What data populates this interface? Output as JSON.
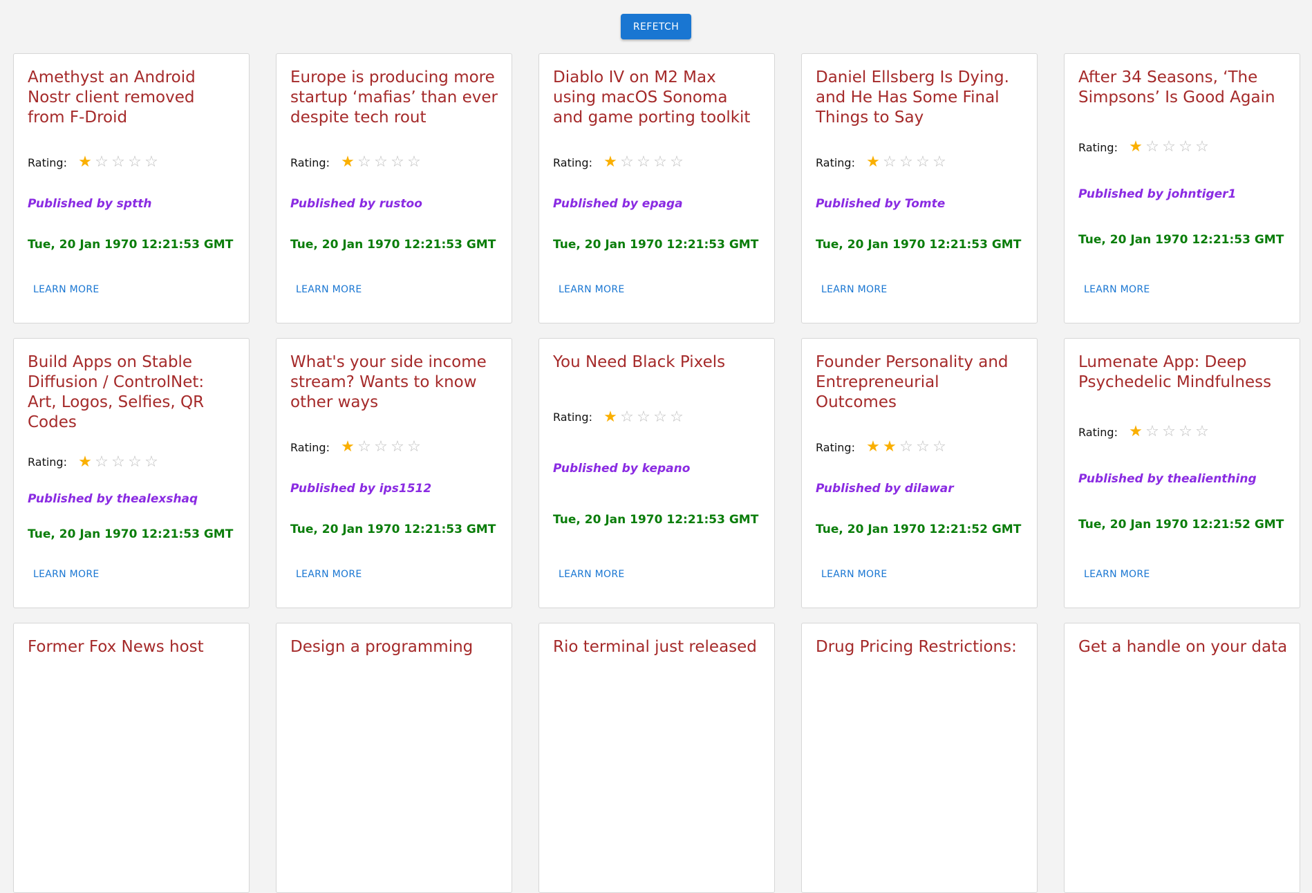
{
  "toolbar": {
    "refetch_label": "REFETCH"
  },
  "labels": {
    "rating": "Rating:",
    "learn_more": "LEARN MORE"
  },
  "colors": {
    "title": "#a52a2a",
    "publisher": "#8a2be2",
    "date": "#0a7d0a",
    "accent": "#1976d2",
    "star": "#faaf00"
  },
  "icons": {
    "filled_star": "star-filled-icon",
    "empty_star": "star-outline-icon"
  },
  "cards": [
    {
      "title": "Amethyst an Android Nostr client removed from F-Droid",
      "rating": 1,
      "publisher": "Published by sptth",
      "date": "Tue, 20 Jan 1970 12:21:53 GMT"
    },
    {
      "title": "Europe is producing more startup ‘mafias’ than ever despite tech rout",
      "rating": 1,
      "publisher": "Published by rustoo",
      "date": "Tue, 20 Jan 1970 12:21:53 GMT"
    },
    {
      "title": "Diablo IV on M2 Max using macOS Sonoma and game porting toolkit",
      "rating": 1,
      "publisher": "Published by epaga",
      "date": "Tue, 20 Jan 1970 12:21:53 GMT"
    },
    {
      "title": "Daniel Ellsberg Is Dying. and He Has Some Final Things to Say",
      "rating": 1,
      "publisher": "Published by Tomte",
      "date": "Tue, 20 Jan 1970 12:21:53 GMT"
    },
    {
      "title": "After 34 Seasons, ‘The Simpsons’ Is Good Again",
      "rating": 1,
      "publisher": "Published by johntiger1",
      "date": "Tue, 20 Jan 1970 12:21:53 GMT"
    },
    {
      "title": "Build Apps on Stable Diffusion / ControlNet: Art, Logos, Selfies, QR Codes",
      "rating": 1,
      "publisher": "Published by thealexshaq",
      "date": "Tue, 20 Jan 1970 12:21:53 GMT"
    },
    {
      "title": "What's your side income stream? Wants to know other ways",
      "rating": 1,
      "publisher": "Published by ips1512",
      "date": "Tue, 20 Jan 1970 12:21:53 GMT"
    },
    {
      "title": "You Need Black Pixels",
      "rating": 1,
      "publisher": "Published by kepano",
      "date": "Tue, 20 Jan 1970 12:21:53 GMT"
    },
    {
      "title": "Founder Personality and Entrepreneurial Outcomes",
      "rating": 2,
      "publisher": "Published by dilawar",
      "date": "Tue, 20 Jan 1970 12:21:52 GMT"
    },
    {
      "title": "Lumenate App: Deep Psychedelic Mindfulness",
      "rating": 1,
      "publisher": "Published by thealienthing",
      "date": "Tue, 20 Jan 1970 12:21:52 GMT"
    }
  ],
  "partial_cards": [
    {
      "title": "Former Fox News host"
    },
    {
      "title": "Design a programming"
    },
    {
      "title": "Rio terminal just released"
    },
    {
      "title": "Drug Pricing Restrictions:"
    },
    {
      "title": "Get a handle on your data"
    }
  ]
}
